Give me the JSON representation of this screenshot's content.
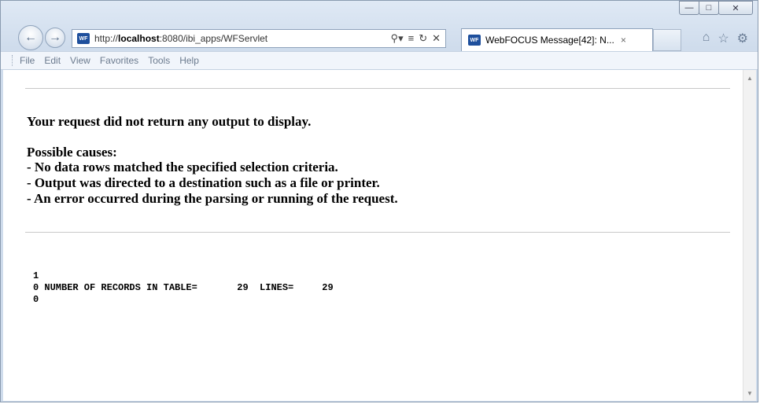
{
  "browser": {
    "url_prefix": "http://",
    "url_host": "localhost",
    "url_rest": ":8080/ibi_apps/WFServlet",
    "tab_title": "WebFOCUS Message[42]: N...",
    "site_icon_text": "WF"
  },
  "menu": [
    "File",
    "Edit",
    "View",
    "Favorites",
    "Tools",
    "Help"
  ],
  "icons": {
    "back": "back-arrow-icon",
    "forward": "forward-arrow-icon",
    "search": "search-icon",
    "refresh": "refresh-icon",
    "stop": "stop-icon",
    "home": "home-icon",
    "favorites": "star-icon",
    "settings": "gear-icon"
  },
  "message": {
    "headline": "Your request did not return any output to display.",
    "causes_title": "Possible causes:",
    "causes": [
      "- No data rows matched the specified selection criteria.",
      "- Output was directed to a destination such as a file or printer.",
      "- An error occurred during the parsing or running of the request."
    ]
  },
  "report": {
    "line1": "1",
    "line2": "0 NUMBER OF RECORDS IN TABLE=       29  LINES=     29",
    "line3": "0"
  },
  "colors": {
    "chrome": "#cfdcec",
    "accent": "#1e4f9c"
  }
}
